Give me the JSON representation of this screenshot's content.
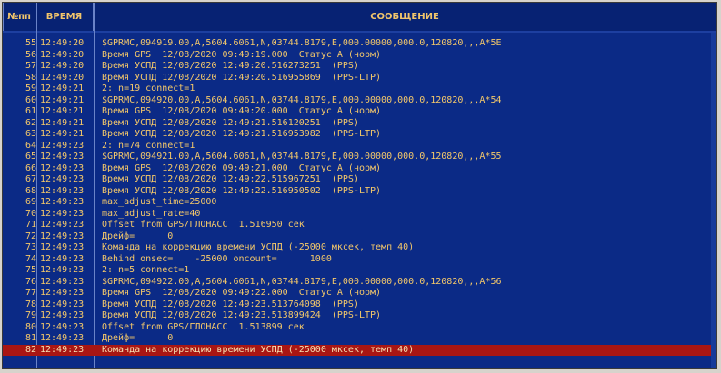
{
  "headers": {
    "num": "№пп",
    "time": "ВРЕМЯ",
    "message": "СООБЩЕНИЕ"
  },
  "rows": [
    {
      "n": "55",
      "t": "12:49:20",
      "m": "$GPRMC,094919.00,A,5604.6061,N,03744.8179,E,000.00000,000.0,120820,,,A*5E"
    },
    {
      "n": "56",
      "t": "12:49:20",
      "m": "Время GPS  12/08/2020 09:49:19.000  Статус A (норм)"
    },
    {
      "n": "57",
      "t": "12:49:20",
      "m": "Время УСПД 12/08/2020 12:49:20.516273251  (PPS)"
    },
    {
      "n": "58",
      "t": "12:49:20",
      "m": "Время УСПД 12/08/2020 12:49:20.516955869  (PPS-LTP)"
    },
    {
      "n": "59",
      "t": "12:49:21",
      "m": "2: n=19 connect=1"
    },
    {
      "n": "60",
      "t": "12:49:21",
      "m": "$GPRMC,094920.00,A,5604.6061,N,03744.8179,E,000.00000,000.0,120820,,,A*54"
    },
    {
      "n": "61",
      "t": "12:49:21",
      "m": "Время GPS  12/08/2020 09:49:20.000  Статус A (норм)"
    },
    {
      "n": "62",
      "t": "12:49:21",
      "m": "Время УСПД 12/08/2020 12:49:21.516120251  (PPS)"
    },
    {
      "n": "63",
      "t": "12:49:21",
      "m": "Время УСПД 12/08/2020 12:49:21.516953982  (PPS-LTP)"
    },
    {
      "n": "64",
      "t": "12:49:23",
      "m": "2: n=74 connect=1"
    },
    {
      "n": "65",
      "t": "12:49:23",
      "m": "$GPRMC,094921.00,A,5604.6061,N,03744.8179,E,000.00000,000.0,120820,,,A*55"
    },
    {
      "n": "66",
      "t": "12:49:23",
      "m": "Время GPS  12/08/2020 09:49:21.000  Статус A (норм)"
    },
    {
      "n": "67",
      "t": "12:49:23",
      "m": "Время УСПД 12/08/2020 12:49:22.515967251  (PPS)"
    },
    {
      "n": "68",
      "t": "12:49:23",
      "m": "Время УСПД 12/08/2020 12:49:22.516950502  (PPS-LTP)"
    },
    {
      "n": "69",
      "t": "12:49:23",
      "m": "max_adjust_time=25000"
    },
    {
      "n": "70",
      "t": "12:49:23",
      "m": "max_adjust_rate=40"
    },
    {
      "n": "71",
      "t": "12:49:23",
      "m": "Offset from GPS/ГЛОНАСС  1.516950 сек"
    },
    {
      "n": "72",
      "t": "12:49:23",
      "m": "Дрейф=      0"
    },
    {
      "n": "73",
      "t": "12:49:23",
      "m": "Команда на коррекцию времени УСПД (-25000 мксек, темп 40)"
    },
    {
      "n": "74",
      "t": "12:49:23",
      "m": "Behind onsec=    -25000 oncount=      1000"
    },
    {
      "n": "75",
      "t": "12:49:23",
      "m": "2: n=5 connect=1"
    },
    {
      "n": "76",
      "t": "12:49:23",
      "m": "$GPRMC,094922.00,A,5604.6061,N,03744.8179,E,000.00000,000.0,120820,,,A*56"
    },
    {
      "n": "77",
      "t": "12:49:23",
      "m": "Время GPS  12/08/2020 09:49:22.000  Статус A (норм)"
    },
    {
      "n": "78",
      "t": "12:49:23",
      "m": "Время УСПД 12/08/2020 12:49:23.513764098  (PPS)"
    },
    {
      "n": "79",
      "t": "12:49:23",
      "m": "Время УСПД 12/08/2020 12:49:23.513899424  (PPS-LTP)"
    },
    {
      "n": "80",
      "t": "12:49:23",
      "m": "Offset from GPS/ГЛОНАСС  1.513899 сек"
    },
    {
      "n": "81",
      "t": "12:49:23",
      "m": "Дрейф=      0"
    },
    {
      "n": "82",
      "t": "12:49:23",
      "m": "Команда на коррекцию времени УСПД (-25000 мксек, темп 40)"
    }
  ],
  "selected_row": "82",
  "colors": {
    "background": "#0b2a86",
    "text": "#f4c86a",
    "selected": "#a91613"
  }
}
